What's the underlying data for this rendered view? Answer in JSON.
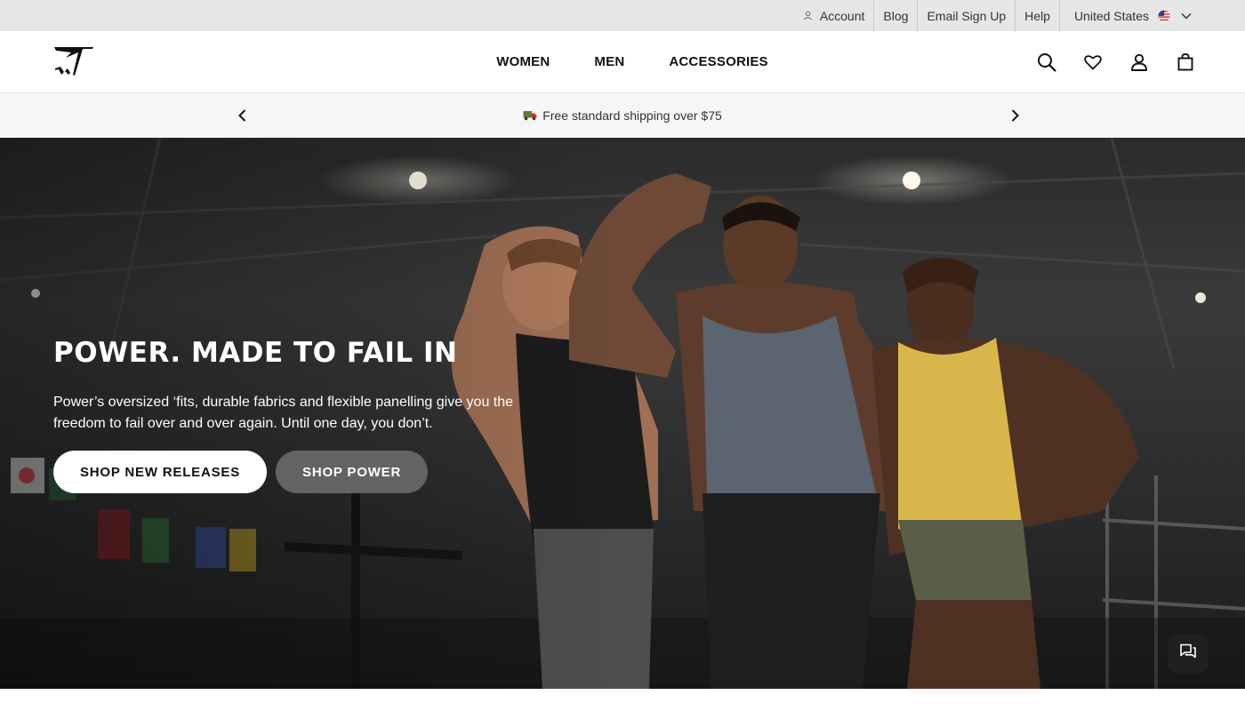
{
  "utility_bar": {
    "account": "Account",
    "blog": "Blog",
    "email_signup": "Email Sign Up",
    "help": "Help",
    "country": "United States",
    "account_icon": "person-icon",
    "flag_icon": "us-flag-icon",
    "dropdown_icon": "chevron-down-icon"
  },
  "header": {
    "logo_icon": "shark-logo-icon",
    "nav": [
      "WOMEN",
      "MEN",
      "ACCESSORIES"
    ],
    "icons": [
      "search-icon",
      "heart-icon",
      "user-icon",
      "bag-icon"
    ]
  },
  "promo": {
    "text": "Free standard shipping over $75",
    "truck_icon": "truck-icon",
    "prev_icon": "chevron-left-icon",
    "next_icon": "chevron-right-icon"
  },
  "hero": {
    "title": "POWER. MADE TO FAIL IN",
    "description": "Power’s oversized ‘fits, durable fabrics and flexible panelling give you the freedom to fail over and over again. Until one day, you don’t.",
    "cta_primary": "SHOP NEW RELEASES",
    "cta_secondary": "SHOP POWER"
  },
  "chat": {
    "icon": "chat-icon"
  },
  "colors": {
    "utility_bg": "#e6e6e6",
    "promo_bg": "#f6f6f6",
    "tank_grey": "#5b6471",
    "tank_yellow": "#d9b64c",
    "tank_black": "#1c1c1c"
  }
}
